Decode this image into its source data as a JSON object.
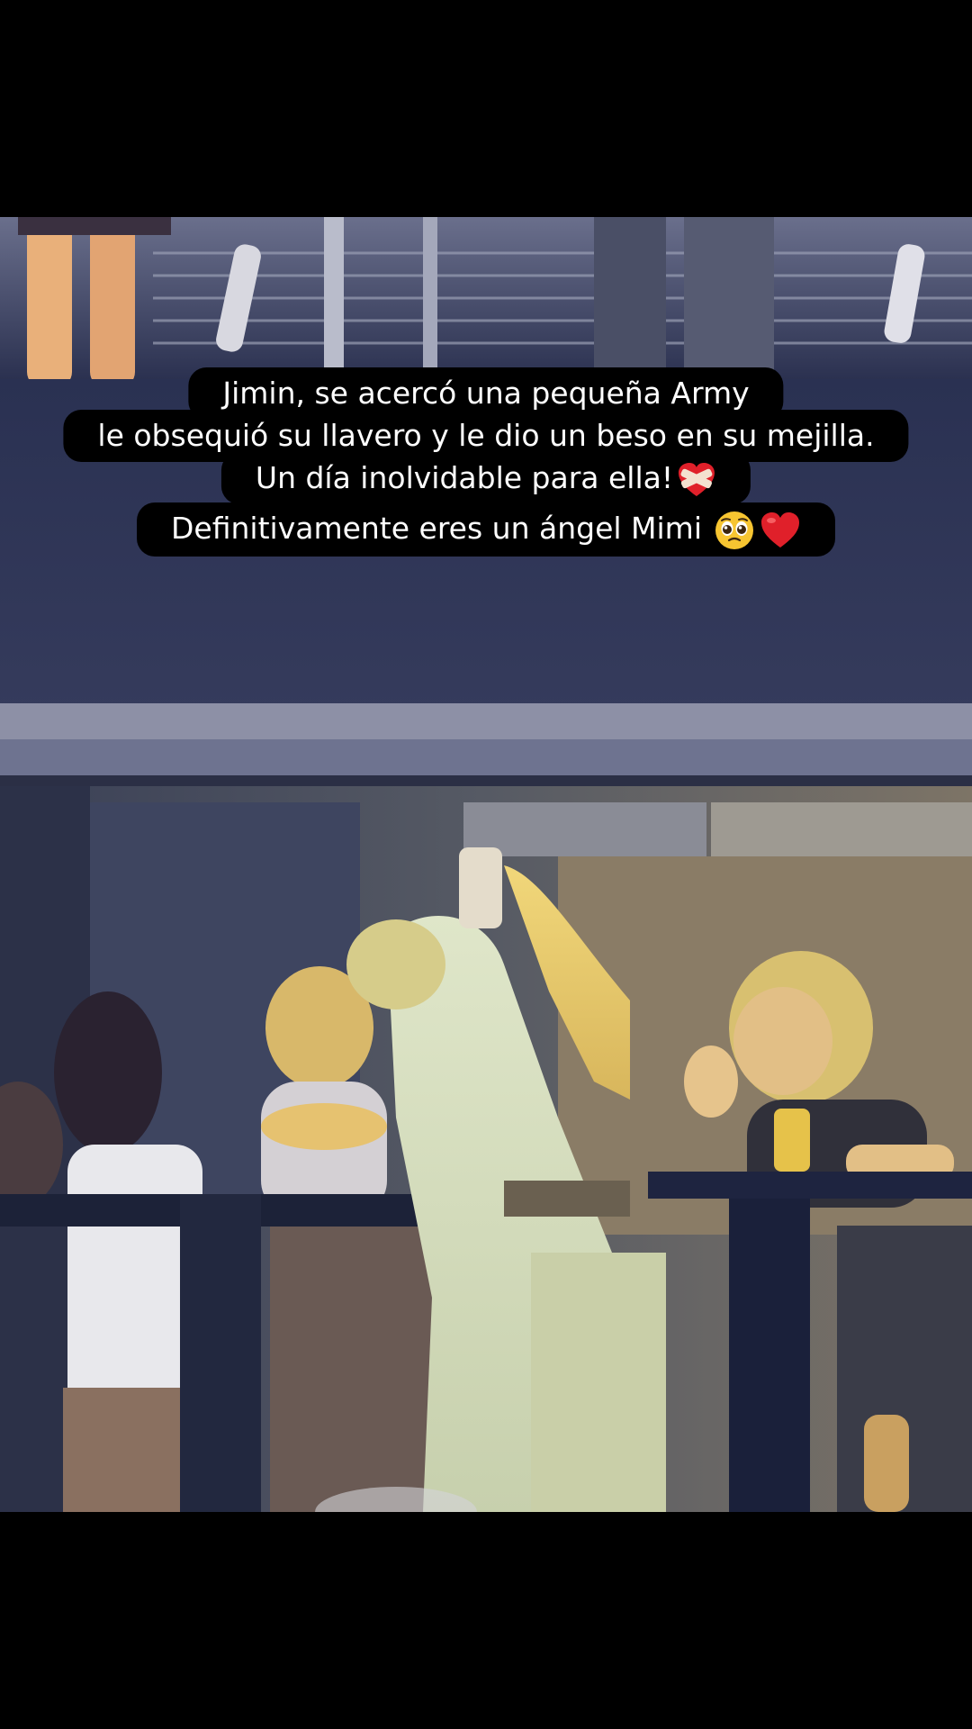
{
  "caption": {
    "line1": "Jimin, se acercó una pequeña Army",
    "line2": "le obsequió su llavero y le dio un beso en su mejilla.",
    "line3": "Un día inolvidable para ella!",
    "line4": "Definitivamente eres un ángel Mimi",
    "line3_emoji": "mending-heart-icon",
    "line4_emojis": [
      "pleading-face-icon",
      "red-heart-icon"
    ]
  },
  "colors": {
    "background": "#000000",
    "caption_bg": "#000000",
    "caption_text": "#ffffff",
    "heart": "#e0202a"
  }
}
